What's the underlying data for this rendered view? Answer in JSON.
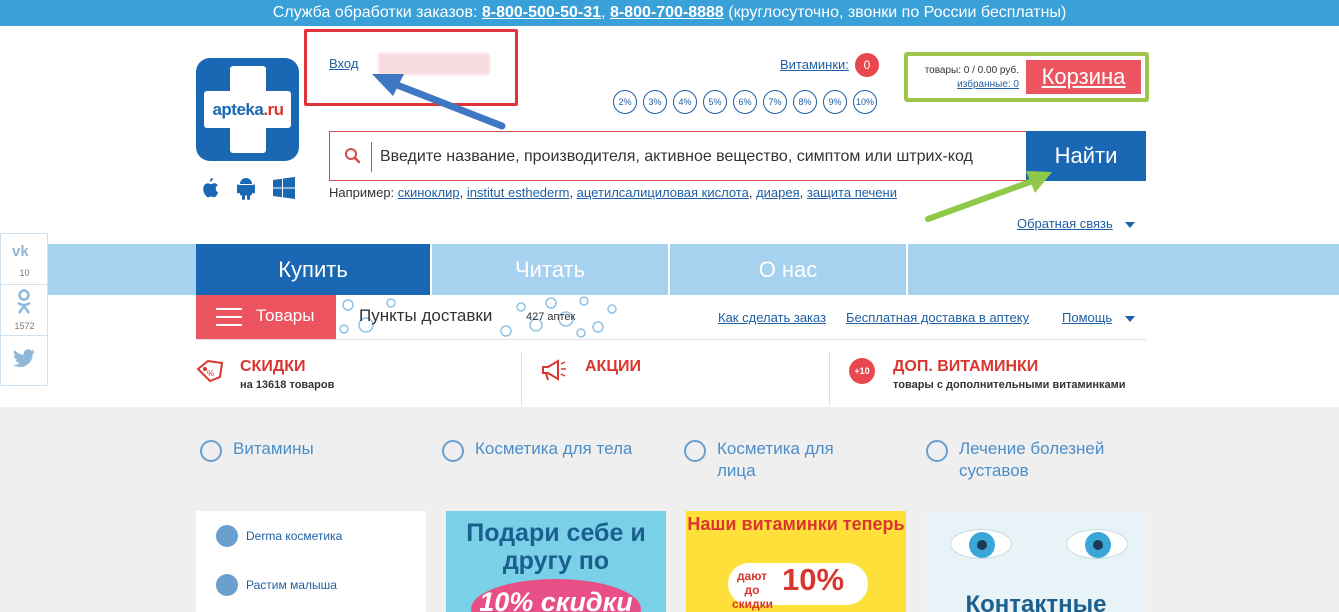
{
  "topbar": {
    "prefix": "Служба обработки заказов:",
    "phone1": "8-800-500-50-31",
    "sep": ",",
    "phone2": "8-800-700-8888",
    "suffix": "(круглосуточно, звонки по России бесплатны)"
  },
  "logo": {
    "text_main": "apteka",
    "text_dot": ".ru"
  },
  "os_icons": [
    "apple-icon",
    "android-icon",
    "windows-icon"
  ],
  "login": {
    "label": "Вход"
  },
  "vitamins": {
    "label": "Витаминки:",
    "count": "0"
  },
  "percents": [
    "2%",
    "3%",
    "4%",
    "5%",
    "6%",
    "7%",
    "8%",
    "9%",
    "10%"
  ],
  "cart": {
    "summary": "товары: 0 / 0.00 руб.",
    "favorites": "избранные: 0",
    "button": "Корзина"
  },
  "search": {
    "placeholder": "Введите название, производителя, активное вещество, симптом или штрих-код",
    "button": "Найти"
  },
  "examples": {
    "prefix": "Например:",
    "items": [
      "скиноклир",
      "institut esthederm",
      "ацетилсалициловая кислота",
      "диарея",
      "защита печени"
    ]
  },
  "feedback": "Обратная связь",
  "nav": {
    "tabs": [
      "Купить",
      "Читать",
      "О нас"
    ]
  },
  "subnav": {
    "goods": "Товары",
    "pickup": "Пункты доставки",
    "pharmacies": "427 аптек",
    "howto": "Как сделать заказ",
    "free_delivery": "Бесплатная доставка в аптеку",
    "help": "Помощь"
  },
  "promos": [
    {
      "title": "СКИДКИ",
      "sub": "на 13618 товаров"
    },
    {
      "title": "АКЦИИ",
      "sub": ""
    },
    {
      "title": "ДОП. ВИТАМИНКИ",
      "sub": "товары с дополнительными витаминками",
      "badge": "+10"
    }
  ],
  "social": {
    "vk_count": "10",
    "ok_count": "1572"
  },
  "categories": [
    "Витамины",
    "Косметика для тела",
    "Косметика для лица",
    "Лечение болезней суставов"
  ],
  "side_items": [
    "Derma косметика",
    "Растим малыша"
  ],
  "banners": {
    "b1_title": "Подари себе и другу по",
    "b1_discount": "10% скидки",
    "b2_title": "Наши витаминки теперь",
    "b2_small": "дают до скидки",
    "b2_big": "10%",
    "b3_title": "Контактные"
  },
  "colors": {
    "accent_blue": "#1a68b3",
    "accent_red": "#ec5560",
    "topbar": "#3aa0d8",
    "nav_light": "#a6d1ef",
    "cart_border": "#9fc54a"
  }
}
